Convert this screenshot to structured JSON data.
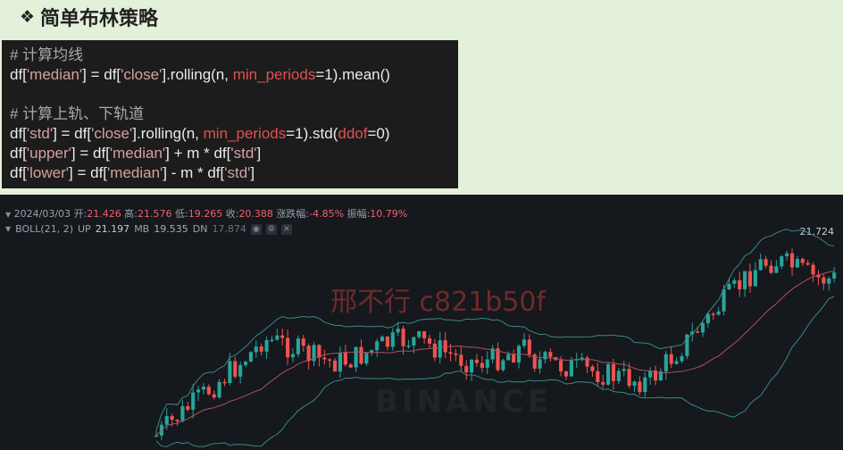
{
  "slide": {
    "bullet": "❖",
    "title": "简单布林策略"
  },
  "code": {
    "lines": [
      [
        {
          "t": "# 计算均线",
          "c": "comment"
        }
      ],
      [
        {
          "t": "df[",
          "c": ""
        },
        {
          "t": "'median'",
          "c": "str"
        },
        {
          "t": "] = df[",
          "c": ""
        },
        {
          "t": "'close'",
          "c": "str"
        },
        {
          "t": "].rolling(n, ",
          "c": ""
        },
        {
          "t": "min_periods",
          "c": "kw"
        },
        {
          "t": "=1).mean()",
          "c": ""
        }
      ],
      [],
      [
        {
          "t": "# 计算上轨、下轨道",
          "c": "comment"
        }
      ],
      [
        {
          "t": "df[",
          "c": ""
        },
        {
          "t": "'std'",
          "c": "str"
        },
        {
          "t": "] = df[",
          "c": ""
        },
        {
          "t": "'close'",
          "c": "str"
        },
        {
          "t": "].rolling(n, ",
          "c": ""
        },
        {
          "t": "min_periods",
          "c": "kw"
        },
        {
          "t": "=1).std(",
          "c": ""
        },
        {
          "t": "ddof",
          "c": "kw"
        },
        {
          "t": "=0)",
          "c": ""
        }
      ],
      [
        {
          "t": "df[",
          "c": ""
        },
        {
          "t": "'upper'",
          "c": "str"
        },
        {
          "t": "] = df[",
          "c": ""
        },
        {
          "t": "'median'",
          "c": "str"
        },
        {
          "t": "] + m * df[",
          "c": ""
        },
        {
          "t": "'std'",
          "c": "str"
        },
        {
          "t": "]",
          "c": ""
        }
      ],
      [
        {
          "t": "df[",
          "c": ""
        },
        {
          "t": "'lower'",
          "c": "str"
        },
        {
          "t": "] = df[",
          "c": ""
        },
        {
          "t": "'median'",
          "c": "str"
        },
        {
          "t": "] - m * df[",
          "c": ""
        },
        {
          "t": "'std'",
          "c": "str"
        },
        {
          "t": "]",
          "c": ""
        }
      ]
    ]
  },
  "chart": {
    "date": "2024/03/03",
    "open_label": "开:",
    "open": "21.426",
    "high_label": "高:",
    "high": "21.576",
    "low_label": "低:",
    "low": "19.265",
    "close_label": "收:",
    "close": "20.388",
    "change_label": "涨跌幅:",
    "change": "-4.85%",
    "amplitude_label": "振幅:",
    "amplitude": "10.79%",
    "boll_label": "BOLL(21, 2)",
    "up_label": "UP",
    "up": "21.197",
    "mb_label": "MB",
    "mb": "19.535",
    "dn_label": "DN",
    "dn": "17.874",
    "price_tag": "21.724",
    "watermark": "邢不行 c821b50f",
    "exchange_watermark": "BINANCE",
    "colors": {
      "up": "#26a69a",
      "down": "#ef5350",
      "band": "#3a8a80",
      "median": "#b05060",
      "bg": "#15181d"
    }
  }
}
